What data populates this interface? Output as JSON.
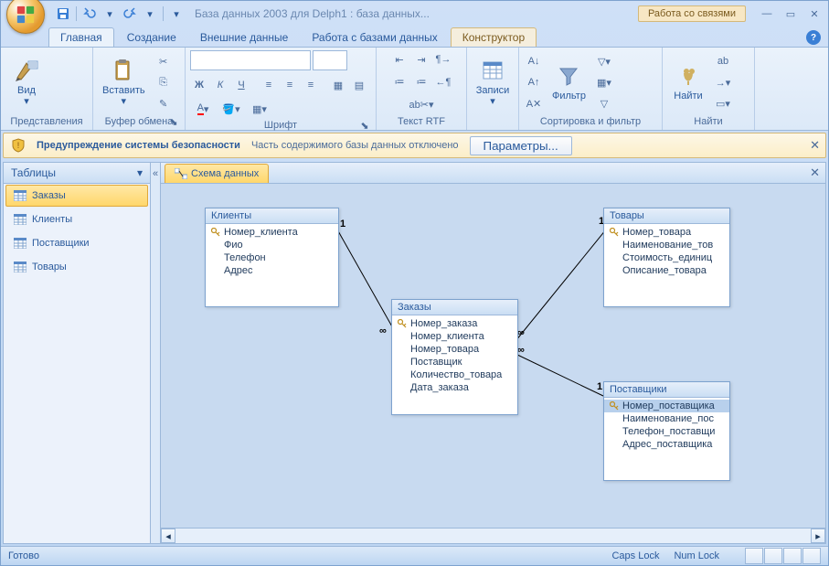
{
  "title": "База данных 2003 для Delph1 : база данных...",
  "context_tab": "Работа со связями",
  "tabs": [
    "Главная",
    "Создание",
    "Внешние данные",
    "Работа с базами данных",
    "Конструктор"
  ],
  "ribbon_groups": {
    "view": {
      "label": "Вид",
      "group": "Представления"
    },
    "paste": {
      "label": "Вставить",
      "group": "Буфер обмена"
    },
    "font": {
      "group": "Шрифт"
    },
    "rtf": {
      "group": "Текст RTF"
    },
    "records": {
      "label": "Записи"
    },
    "filter": {
      "label": "Фильтр",
      "group": "Сортировка и фильтр"
    },
    "find": {
      "label": "Найти",
      "group": "Найти"
    }
  },
  "security": {
    "bold": "Предупреждение системы безопасности",
    "text": "Часть содержимого базы данных отключено",
    "button": "Параметры..."
  },
  "navpane": {
    "header": "Таблицы",
    "items": [
      "Заказы",
      "Клиенты",
      "Поставщики",
      "Товары"
    ]
  },
  "doc_tab": "Схема данных",
  "tables": {
    "clients": {
      "title": "Клиенты",
      "fields": [
        "Номер_клиента",
        "Фио",
        "Телефон",
        "Адрес"
      ],
      "keys": [
        0
      ]
    },
    "orders": {
      "title": "Заказы",
      "fields": [
        "Номер_заказа",
        "Номер_клиента",
        "Номер_товара",
        "Поставщик",
        "Количество_товара",
        "Дата_заказа"
      ],
      "keys": [
        0
      ]
    },
    "goods": {
      "title": "Товары",
      "fields": [
        "Номер_товара",
        "Наименование_тов",
        "Стоимость_единиц",
        "Описание_товара"
      ],
      "keys": [
        0
      ]
    },
    "suppliers": {
      "title": "Поставщики",
      "fields": [
        "Номер_поставщика",
        "Наименование_пос",
        "Телефон_поставщи",
        "Адрес_поставщика"
      ],
      "keys": [
        0
      ],
      "sel": 0
    }
  },
  "status": {
    "left": "Готово",
    "caps": "Caps Lock",
    "num": "Num Lock"
  }
}
